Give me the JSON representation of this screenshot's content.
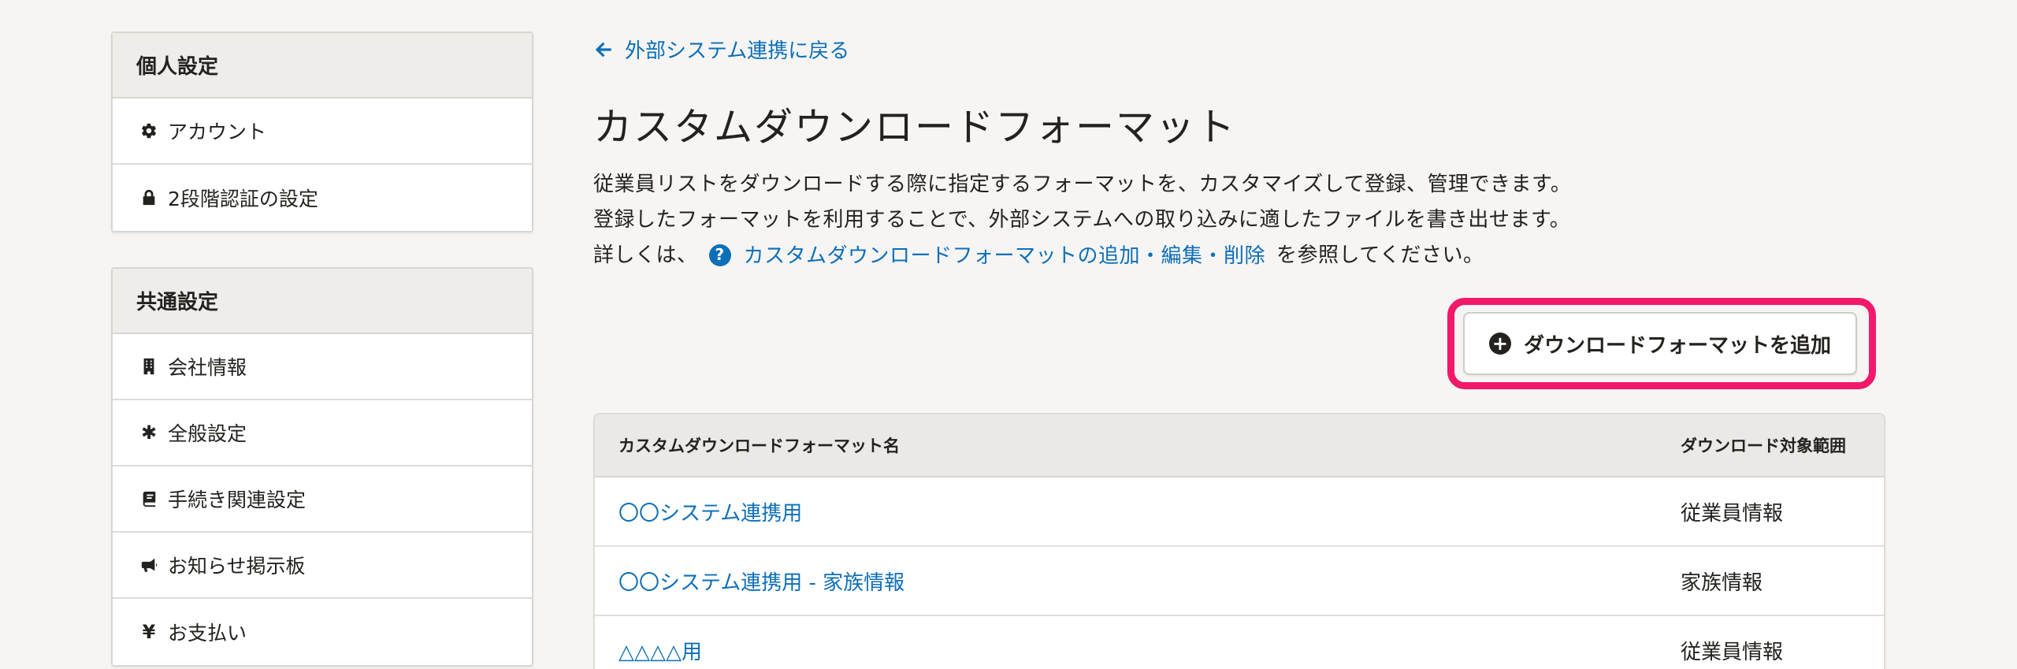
{
  "sidebar": {
    "personal": {
      "heading": "個人設定",
      "items": [
        {
          "label": "アカウント",
          "icon": "gear-icon"
        },
        {
          "label": "2段階認証の設定",
          "icon": "lock-icon"
        }
      ]
    },
    "common": {
      "heading": "共通設定",
      "items": [
        {
          "label": "会社情報",
          "icon": "building-icon"
        },
        {
          "label": "全般設定",
          "icon": "asterisk-icon",
          "glyph": "✱"
        },
        {
          "label": "手続き関連設定",
          "icon": "book-icon"
        },
        {
          "label": "お知らせ掲示板",
          "icon": "megaphone-icon"
        },
        {
          "label": "お支払い",
          "icon": "yen-icon",
          "glyph": "¥"
        }
      ]
    }
  },
  "main": {
    "back_link": "外部システム連携に戻る",
    "title": "カスタムダウンロードフォーマット",
    "description": {
      "line1": "従業員リストをダウンロードする際に指定するフォーマットを、カスタマイズして登録、管理できます。",
      "line2": "登録したフォーマットを利用することで、外部システムへの取り込みに適したファイルを書き出せます。",
      "line3_prefix": "詳しくは、",
      "help_glyph": "?",
      "help_link": "カスタムダウンロードフォーマットの追加・編集・削除",
      "line3_suffix": "を参照してください。"
    },
    "add_button": {
      "label": "ダウンロードフォーマットを追加",
      "glyph": "+"
    },
    "table": {
      "columns": [
        "カスタムダウンロードフォーマット名",
        "ダウンロード対象範囲"
      ],
      "rows": [
        {
          "name": "〇〇システム連携用",
          "scope": "従業員情報"
        },
        {
          "name": "〇〇システム連携用 - 家族情報",
          "scope": "家族情報"
        },
        {
          "name": "△△△△用",
          "scope": "従業員情報"
        }
      ]
    }
  },
  "colors": {
    "link": "#0d6fb8",
    "highlight": "#f2186a",
    "background": "#f6f5f4",
    "text": "#23221e"
  }
}
